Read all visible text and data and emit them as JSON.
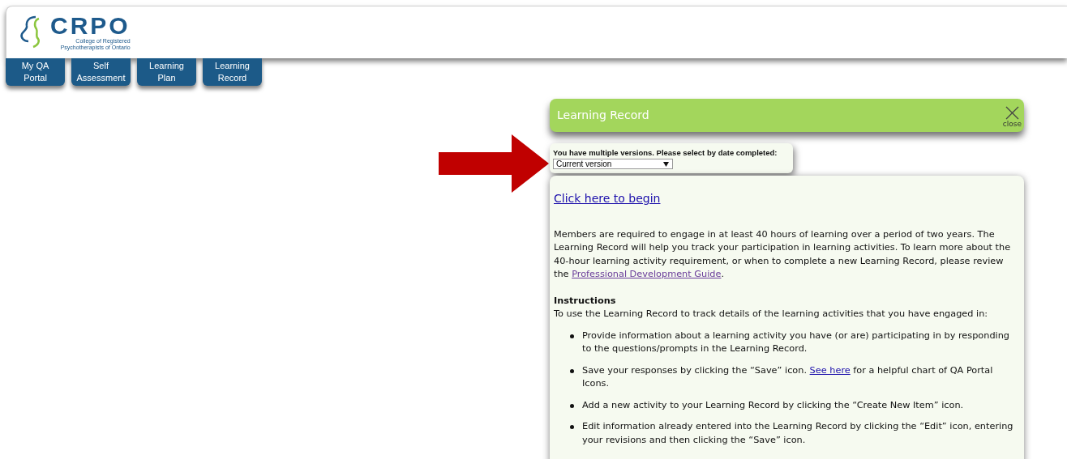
{
  "logo": {
    "wordmark": "CRPO",
    "subtitle_lines": [
      "College of Registered",
      "Psychotherapists of Ontario"
    ]
  },
  "nav_tabs": [
    {
      "label_lines": [
        "My QA",
        "Portal"
      ]
    },
    {
      "label_lines": [
        "Self",
        "Assessment"
      ]
    },
    {
      "label_lines": [
        "Learning",
        "Plan"
      ]
    },
    {
      "label_lines": [
        "Learning",
        "Record"
      ]
    }
  ],
  "dialog": {
    "title": "Learning Record",
    "close_label": "close",
    "version_select": {
      "label": "You have multiple versions. Please select by date completed:",
      "value": "Current version"
    },
    "begin_link": "Click here to begin",
    "intro": [
      {
        "kind": "text",
        "text": "Members are required to engage in at least 40 hours of learning over a period of two years. The Learning Record will help you track your participation in learning activities. To learn more about the 40-hour learning activity requirement, or when to complete a new Learning Record, please review the "
      },
      {
        "kind": "link",
        "text": "Professional Development Guide",
        "visited": true
      },
      {
        "kind": "text",
        "text": "."
      }
    ],
    "instructions_heading": "Instructions",
    "instructions_lead": "To use the Learning Record to track details of the learning activities that you have engaged in:",
    "bullets": [
      [
        {
          "kind": "text",
          "text": "Provide information about a learning activity you have (or are) participating in by responding to the questions/prompts in the Learning Record."
        }
      ],
      [
        {
          "kind": "text",
          "text": "Save your responses by clicking the “Save” icon. "
        },
        {
          "kind": "link",
          "text": "See here",
          "visited": false
        },
        {
          "kind": "text",
          "text": " for a helpful chart of QA Portal Icons."
        }
      ],
      [
        {
          "kind": "text",
          "text": "Add a new activity to your Learning Record by clicking the “Create New Item” icon."
        }
      ],
      [
        {
          "kind": "text",
          "text": "Edit information already entered into the Learning Record by clicking the “Edit” icon, entering your revisions and then clicking the “Save” icon."
        }
      ]
    ]
  }
}
